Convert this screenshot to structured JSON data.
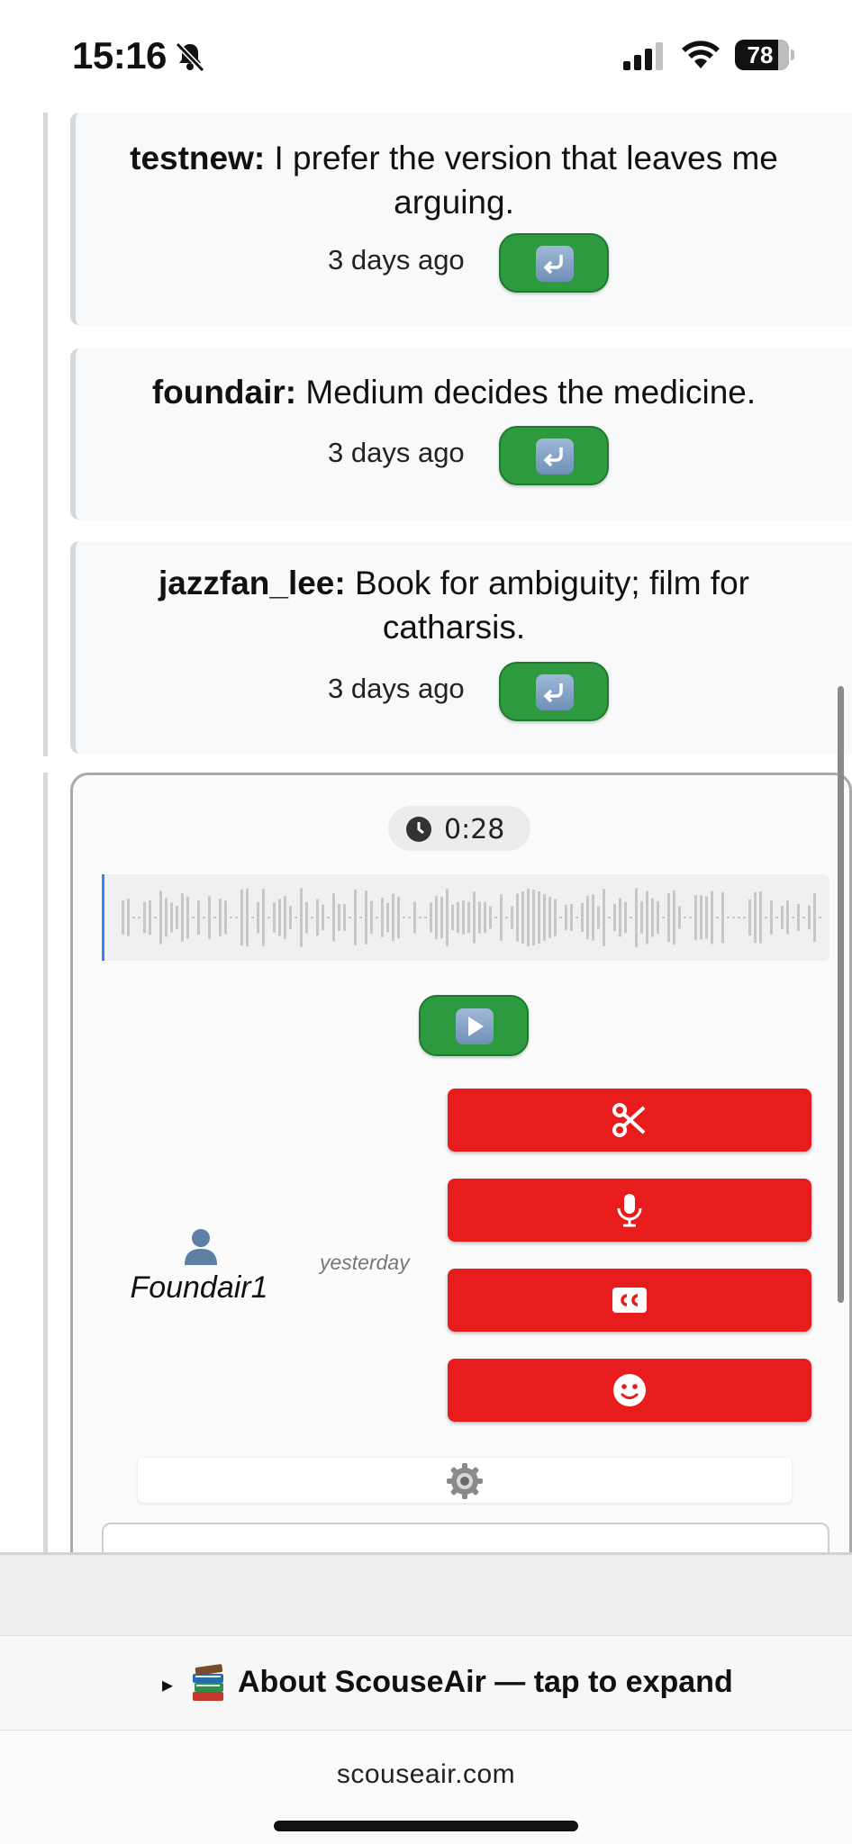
{
  "status_bar": {
    "time": "15:16",
    "battery": "78",
    "icons": [
      "bell-slash-icon",
      "cellular-signal-icon",
      "wifi-icon",
      "battery-icon"
    ]
  },
  "comments": [
    {
      "user": "testnew:",
      "text": " I prefer the version that leaves me arguing.",
      "time": "3 days ago",
      "reply_icon": "reply-arrow-icon"
    },
    {
      "user": "foundair:",
      "text": " Medium decides the medicine.",
      "time": "3 days ago",
      "reply_icon": "reply-arrow-icon"
    },
    {
      "user": "jazzfan_lee:",
      "text": " Book for ambiguity; film for catharsis.",
      "time": "3 days ago",
      "reply_icon": "reply-arrow-icon"
    }
  ],
  "voice_post": {
    "duration": "0:28",
    "play_icon": "play-icon",
    "author": "Foundair1",
    "posted": "yesterday",
    "actions": [
      {
        "name": "scissors-icon"
      },
      {
        "name": "microphone-icon"
      },
      {
        "name": "closed-captions-icon"
      },
      {
        "name": "emoji-smile-icon"
      }
    ],
    "settings_icon": "gear-icon"
  },
  "colors": {
    "reply_green": "#2e9a3f",
    "action_red": "#e81c1c",
    "waveform_bar": "#c7c7c7",
    "waveform_cursor": "#3b82f6"
  },
  "footer": {
    "about_label": "About ScouseAir — tap to expand",
    "about_arrow": "▸",
    "about_icon": "books-icon",
    "url": "scouseair.com"
  }
}
